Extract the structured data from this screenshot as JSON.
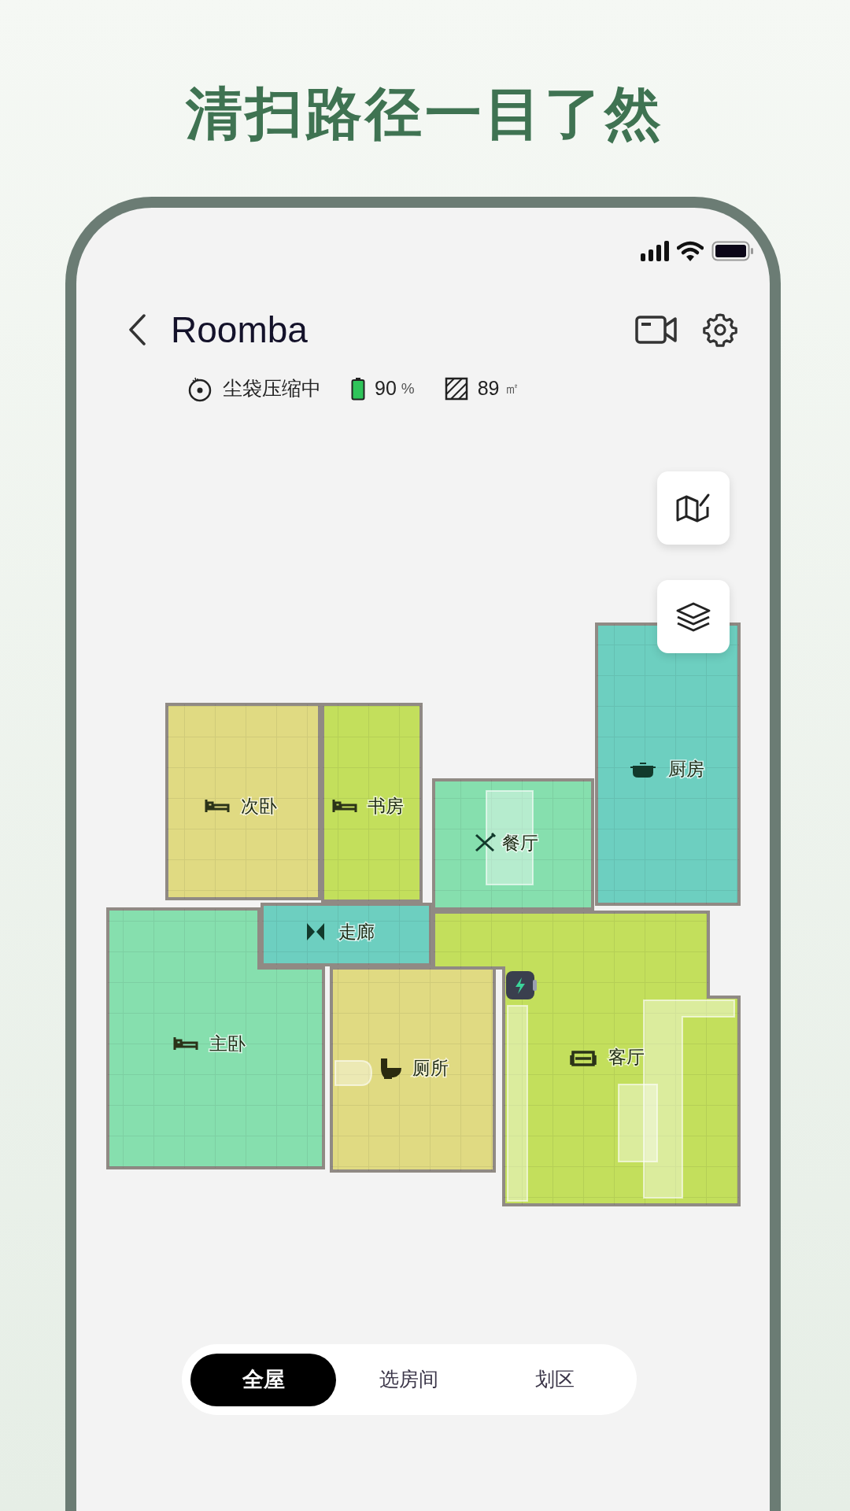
{
  "headline": "清扫路径一目了然",
  "header": {
    "title": "Roomba"
  },
  "stats": [
    {
      "kind": "dustbag",
      "value": "尘袋压缩中"
    },
    {
      "kind": "battery",
      "value": "90",
      "unit": "%"
    },
    {
      "kind": "area",
      "value": "89",
      "unit": "㎡"
    }
  ],
  "rooms": [
    {
      "name": "次卧",
      "kind": "bed",
      "color": "#e0da82"
    },
    {
      "name": "书房",
      "kind": "bed",
      "color": "#c3df5c"
    },
    {
      "name": "餐厅",
      "kind": "dining",
      "color": "#86dfae"
    },
    {
      "name": "厨房",
      "kind": "kitchen",
      "color": "#6dcfc0"
    },
    {
      "name": "走廊",
      "kind": "hall",
      "color": "#6dcfc0"
    },
    {
      "name": "主卧",
      "kind": "bed",
      "color": "#86dfae"
    },
    {
      "name": "厕所",
      "kind": "toilet",
      "color": "#e0da82"
    },
    {
      "name": "客厅",
      "kind": "living",
      "color": "#c3df5c"
    }
  ],
  "modes": [
    {
      "label": "全屋",
      "selected": true
    },
    {
      "label": "选房间",
      "selected": false
    },
    {
      "label": "划区",
      "selected": false
    }
  ]
}
